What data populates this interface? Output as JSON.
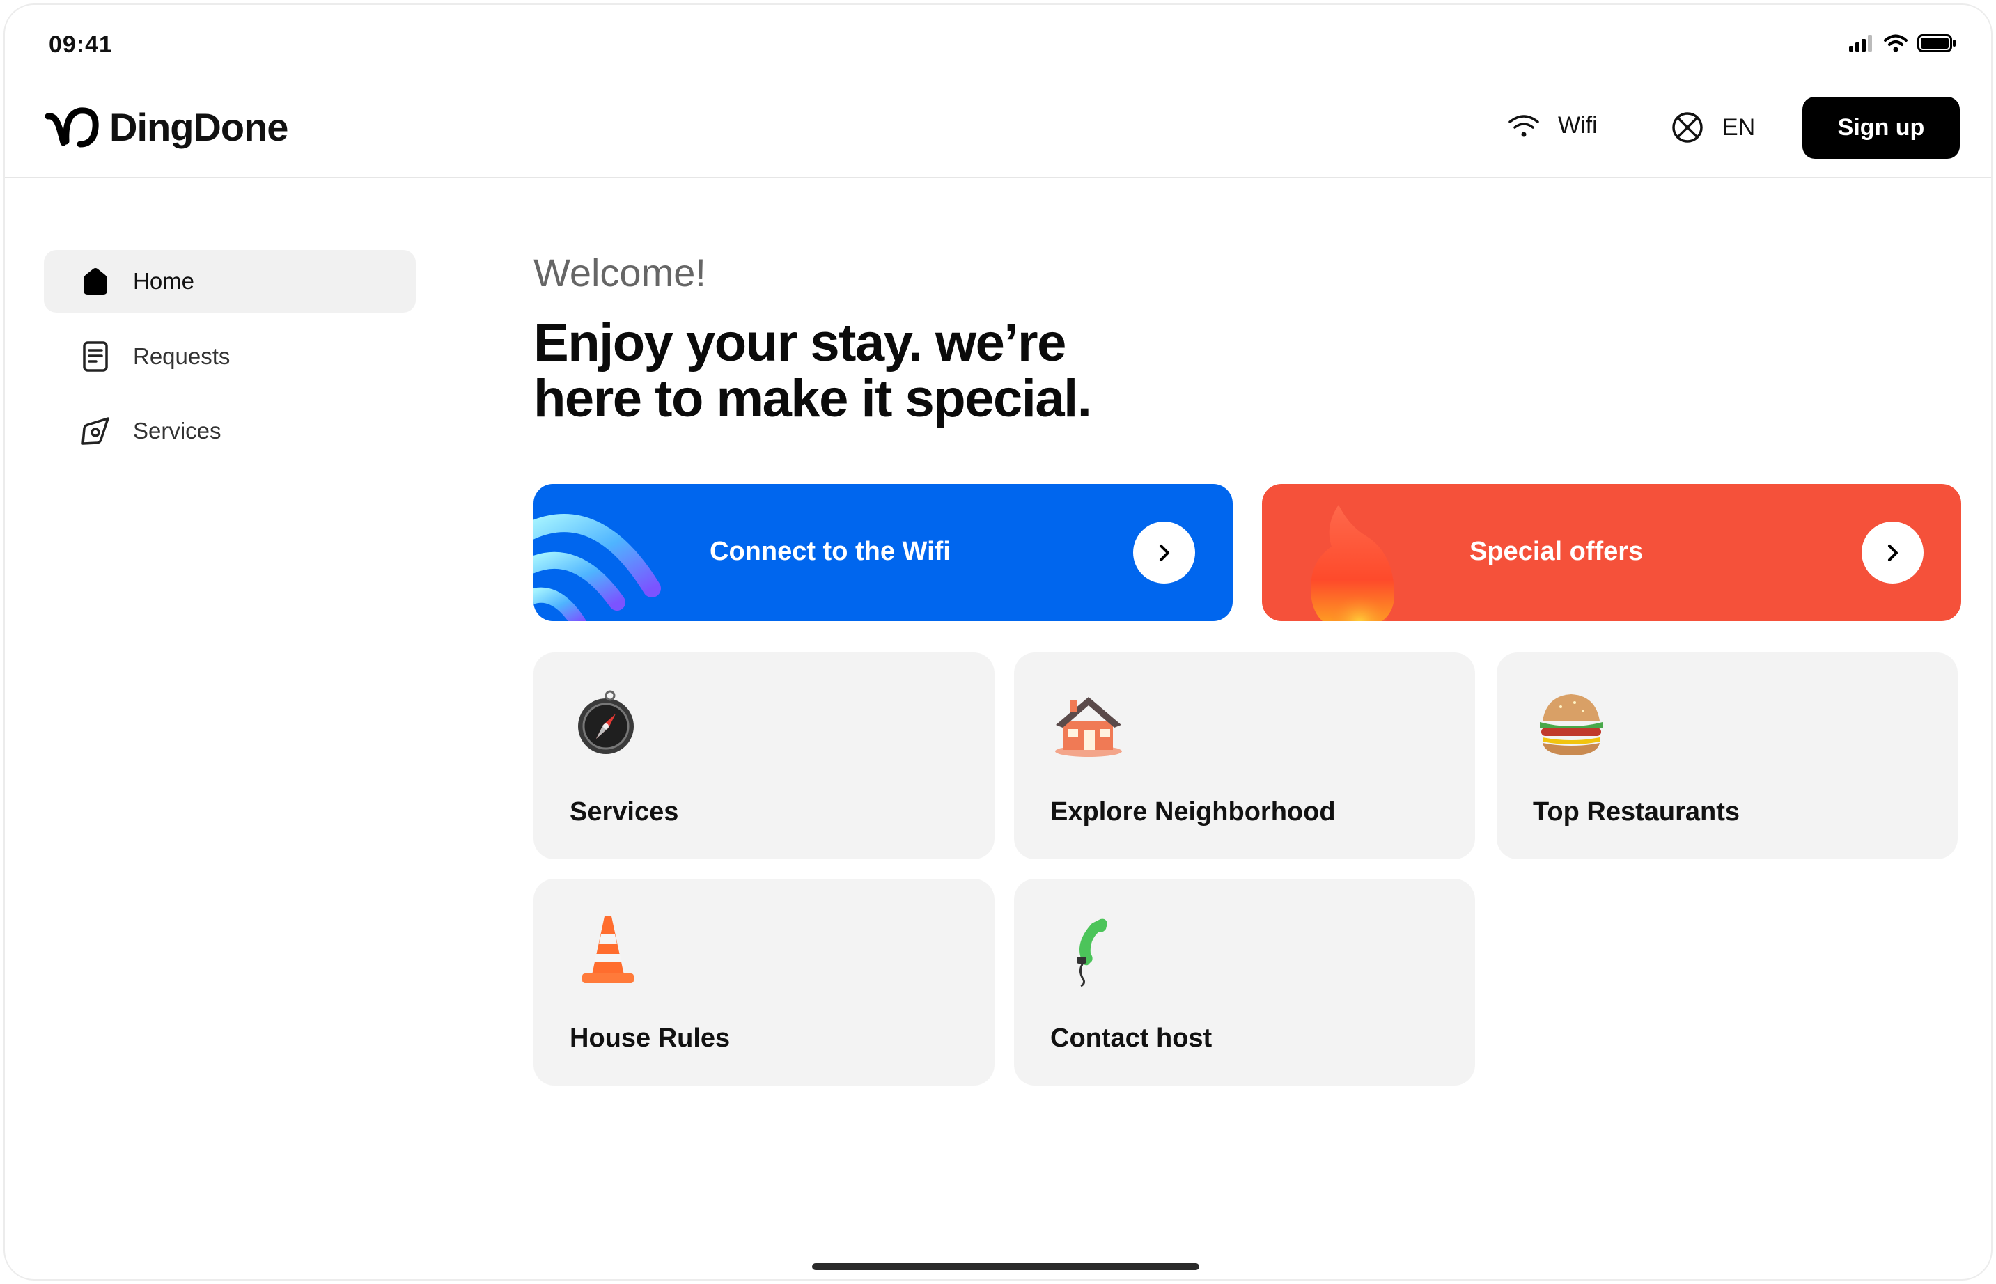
{
  "status_bar": {
    "time": "09:41"
  },
  "header": {
    "brand": "DingDone",
    "wifi_label": "Wifi",
    "language_label": "EN",
    "signup_label": "Sign up"
  },
  "sidebar": {
    "items": [
      {
        "label": "Home",
        "icon": "home-icon",
        "active": true
      },
      {
        "label": "Requests",
        "icon": "document-icon",
        "active": false
      },
      {
        "label": "Services",
        "icon": "compass-icon",
        "active": false
      }
    ]
  },
  "main": {
    "welcome": "Welcome!",
    "headline_line1": "Enjoy your stay. we’re",
    "headline_line2": "here to make it special.",
    "banners": [
      {
        "label": "Connect to the Wifi",
        "icon": "wifi-3d-icon",
        "color": "#0066ee"
      },
      {
        "label": "Special offers",
        "icon": "flame-3d-icon",
        "color": "#f5513a"
      }
    ],
    "tiles": [
      {
        "label": "Services",
        "icon": "compass-3d-icon"
      },
      {
        "label": "Explore Neighborhood",
        "icon": "house-3d-icon"
      },
      {
        "label": "Top Restaurants",
        "icon": "burger-3d-icon"
      },
      {
        "label": "House Rules",
        "icon": "traffic-cone-3d-icon"
      },
      {
        "label": "Contact host",
        "icon": "phone-3d-icon"
      }
    ]
  }
}
